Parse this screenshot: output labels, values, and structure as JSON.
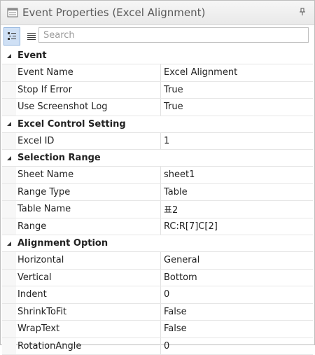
{
  "window": {
    "title": "Event Properties (Excel Alignment)",
    "title_icon": "properties-window-icon",
    "pin_icon": "pin-icon"
  },
  "toolbar": {
    "categorized_icon": "categorized-view-icon",
    "alphabetical_icon": "alphabetical-view-icon",
    "search_placeholder": "Search",
    "search_value": ""
  },
  "categories": [
    {
      "label": "Event",
      "expanded": true,
      "props": [
        {
          "name": "Event Name",
          "value": "Excel Alignment"
        },
        {
          "name": "Stop If Error",
          "value": "True"
        },
        {
          "name": "Use Screenshot Log",
          "value": "True"
        }
      ]
    },
    {
      "label": "Excel Control Setting",
      "expanded": true,
      "props": [
        {
          "name": "Excel ID",
          "value": "1"
        }
      ]
    },
    {
      "label": "Selection Range",
      "expanded": true,
      "props": [
        {
          "name": "Sheet Name",
          "value": "sheet1"
        },
        {
          "name": "Range Type",
          "value": "Table"
        },
        {
          "name": "Table Name",
          "value": "표2"
        },
        {
          "name": "Range",
          "value": "RC:R[7]C[2]"
        }
      ]
    },
    {
      "label": "Alignment Option",
      "expanded": true,
      "props": [
        {
          "name": "Horizontal",
          "value": "General"
        },
        {
          "name": "Vertical",
          "value": "Bottom"
        },
        {
          "name": "Indent",
          "value": "0"
        },
        {
          "name": "ShrinkToFit",
          "value": "False"
        },
        {
          "name": "WrapText",
          "value": "False"
        },
        {
          "name": "RotationAngle",
          "value": "0"
        }
      ]
    }
  ]
}
